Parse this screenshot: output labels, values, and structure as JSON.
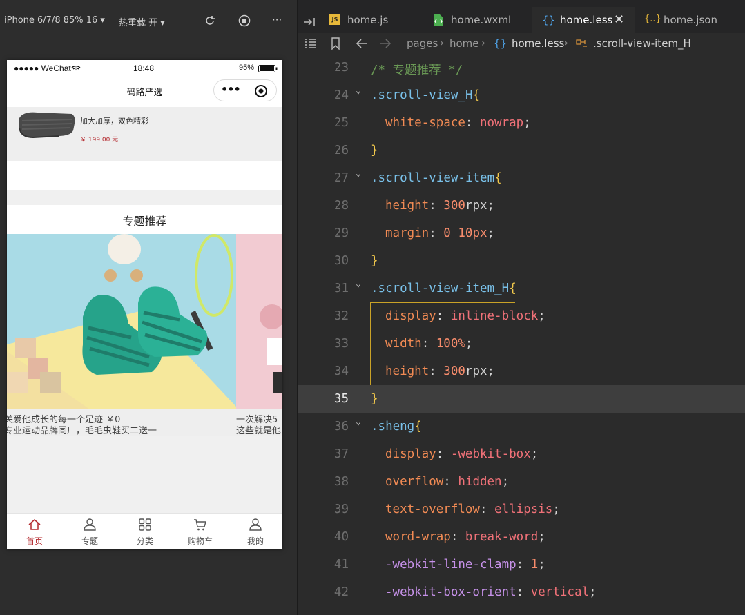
{
  "simulator": {
    "device": "iPhone 6/7/8 85% 16 ▾",
    "hot_reload": "热重载 开 ▾",
    "more": "···",
    "status_bar": {
      "carrier": "●●●●● WeChat",
      "time": "18:48",
      "battery": "95%"
    },
    "nav_title": "码路严选",
    "capsule_more": "•••",
    "product": {
      "desc": "加大加厚，双色精彩",
      "price": "￥ 199.00 元"
    },
    "section_title": "专题推荐",
    "topics": [
      {
        "line1": "关爱他成长的每一个足迹  ￥0",
        "line2": "专业运动品牌同厂，毛毛虫鞋买二送一"
      },
      {
        "line1": "一次解决5",
        "line2": "这些就是他"
      }
    ],
    "tabbar": [
      {
        "label": "首页",
        "icon": "home-icon",
        "active": true
      },
      {
        "label": "专题",
        "icon": "user-icon",
        "active": false
      },
      {
        "label": "分类",
        "icon": "grid-icon",
        "active": false
      },
      {
        "label": "购物车",
        "icon": "cart-icon",
        "active": false
      },
      {
        "label": "我的",
        "icon": "profile-icon",
        "active": false
      }
    ],
    "accent_color": "#b4282d"
  },
  "editor": {
    "tabs": [
      {
        "label": "home.js",
        "icon": "js-file-icon",
        "active": false
      },
      {
        "label": "home.wxml",
        "icon": "wxml-file-icon",
        "active": false
      },
      {
        "label": "home.less",
        "icon": "less-file-icon",
        "active": true
      },
      {
        "label": "home.json",
        "icon": "json-file-icon",
        "active": false
      }
    ],
    "breadcrumb": [
      "pages",
      "home",
      "home.less",
      ".scroll-view-item_H"
    ],
    "current_line": 35,
    "lines": [
      {
        "n": "23",
        "tokens": [
          [
            "/* 专题推荐 */",
            "#6a9955"
          ]
        ]
      },
      {
        "n": "24",
        "fold": true,
        "tokens": [
          [
            ".scroll-view_H",
            "#79c0e8"
          ],
          [
            "{",
            "#f2c94c"
          ]
        ]
      },
      {
        "n": "25",
        "indent": 1,
        "tokens": [
          [
            "white-space",
            "#f28b54"
          ],
          [
            ": ",
            "#d4d4d4"
          ],
          [
            "nowrap",
            "#f07178"
          ],
          [
            ";",
            "#d4d4d4"
          ]
        ]
      },
      {
        "n": "26",
        "tokens": [
          [
            "}",
            "#f2c94c"
          ]
        ]
      },
      {
        "n": "27",
        "fold": true,
        "tokens": [
          [
            ".scroll-view-item",
            "#79c0e8"
          ],
          [
            "{",
            "#f2c94c"
          ]
        ]
      },
      {
        "n": "28",
        "indent": 1,
        "tokens": [
          [
            "height",
            "#f28b54"
          ],
          [
            ": ",
            "#d4d4d4"
          ],
          [
            "300",
            "#f78c6c"
          ],
          [
            "rpx",
            "#d4d4d4"
          ],
          [
            ";",
            "#d4d4d4"
          ]
        ]
      },
      {
        "n": "29",
        "indent": 1,
        "tokens": [
          [
            "margin",
            "#f28b54"
          ],
          [
            ": ",
            "#d4d4d4"
          ],
          [
            "0 10px",
            "#f78c6c"
          ],
          [
            ";",
            "#d4d4d4"
          ]
        ]
      },
      {
        "n": "30",
        "tokens": [
          [
            "}",
            "#f2c94c"
          ]
        ]
      },
      {
        "n": "31",
        "fold": true,
        "tokens": [
          [
            ".scroll-view-item_H",
            "#79c0e8"
          ],
          [
            "{",
            "#f2c94c"
          ]
        ]
      },
      {
        "n": "32",
        "indent": 1,
        "tokens": [
          [
            "display",
            "#f28b54"
          ],
          [
            ": ",
            "#d4d4d4"
          ],
          [
            "inline-block",
            "#f07178"
          ],
          [
            ";",
            "#d4d4d4"
          ]
        ]
      },
      {
        "n": "33",
        "indent": 1,
        "tokens": [
          [
            "width",
            "#f28b54"
          ],
          [
            ": ",
            "#d4d4d4"
          ],
          [
            "100%",
            "#f78c6c"
          ],
          [
            ";",
            "#d4d4d4"
          ]
        ]
      },
      {
        "n": "34",
        "indent": 1,
        "tokens": [
          [
            "height",
            "#f28b54"
          ],
          [
            ": ",
            "#d4d4d4"
          ],
          [
            "300",
            "#f78c6c"
          ],
          [
            "rpx",
            "#d4d4d4"
          ],
          [
            ";",
            "#d4d4d4"
          ]
        ]
      },
      {
        "n": "35",
        "tokens": [
          [
            "}",
            "#f2c94c"
          ]
        ]
      },
      {
        "n": "36",
        "fold": true,
        "tokens": [
          [
            ".sheng",
            "#79c0e8"
          ],
          [
            "{",
            "#f2c94c"
          ]
        ]
      },
      {
        "n": "37",
        "indent": 1,
        "tokens": [
          [
            "display",
            "#f28b54"
          ],
          [
            ": ",
            "#d4d4d4"
          ],
          [
            "-webkit-box",
            "#f07178"
          ],
          [
            ";",
            "#d4d4d4"
          ]
        ]
      },
      {
        "n": "38",
        "indent": 1,
        "tokens": [
          [
            "overflow",
            "#f28b54"
          ],
          [
            ": ",
            "#d4d4d4"
          ],
          [
            "hidden",
            "#f07178"
          ],
          [
            ";",
            "#d4d4d4"
          ]
        ]
      },
      {
        "n": "39",
        "indent": 1,
        "tokens": [
          [
            "text-overflow",
            "#f28b54"
          ],
          [
            ": ",
            "#d4d4d4"
          ],
          [
            "ellipsis",
            "#f07178"
          ],
          [
            ";",
            "#d4d4d4"
          ]
        ]
      },
      {
        "n": "40",
        "indent": 1,
        "tokens": [
          [
            "word-wrap",
            "#f28b54"
          ],
          [
            ": ",
            "#d4d4d4"
          ],
          [
            "break-word",
            "#f07178"
          ],
          [
            ";",
            "#d4d4d4"
          ]
        ]
      },
      {
        "n": "41",
        "indent": 1,
        "tokens": [
          [
            "-webkit-line-clamp",
            "#c792ea"
          ],
          [
            ": ",
            "#d4d4d4"
          ],
          [
            "1",
            "#f78c6c"
          ],
          [
            ";",
            "#d4d4d4"
          ]
        ]
      },
      {
        "n": "42",
        "indent": 1,
        "tokens": [
          [
            "-webkit-box-orient",
            "#c792ea"
          ],
          [
            ": ",
            "#d4d4d4"
          ],
          [
            "vertical",
            "#f07178"
          ],
          [
            ";",
            "#d4d4d4"
          ]
        ]
      }
    ]
  }
}
